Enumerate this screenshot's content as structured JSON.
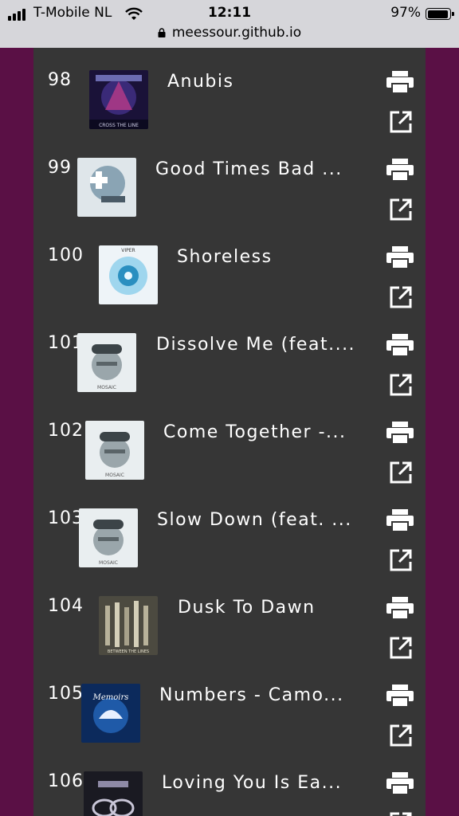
{
  "status_bar": {
    "carrier": "T-Mobile NL",
    "time": "12:11",
    "battery_percent": "97%",
    "url": "meessour.github.io",
    "icons": [
      "signal-icon",
      "wifi-icon",
      "battery-icon",
      "lock-icon"
    ]
  },
  "colors": {
    "page_background": "#5a1045",
    "panel_background": "#363636",
    "text": "#ffffff",
    "status_bar_background": "#d6d6da"
  },
  "tracks": [
    {
      "number": "98",
      "title": "Anubis",
      "cover_caption": "CROSS THE LINE",
      "actions": [
        "print-icon",
        "open-external-icon"
      ]
    },
    {
      "number": "99",
      "title": "Good Times Bad ...",
      "cover_caption": "",
      "actions": [
        "print-icon",
        "open-external-icon"
      ]
    },
    {
      "number": "100",
      "title": "Shoreless",
      "cover_caption": "VIPER",
      "actions": [
        "print-icon",
        "open-external-icon"
      ]
    },
    {
      "number": "101",
      "title": "Dissolve Me (feat....",
      "cover_caption": "MOSAIC",
      "actions": [
        "print-icon",
        "open-external-icon"
      ]
    },
    {
      "number": "102",
      "title": "Come Together -...",
      "cover_caption": "MOSAIC",
      "actions": [
        "print-icon",
        "open-external-icon"
      ]
    },
    {
      "number": "103",
      "title": "Slow Down (feat. ...",
      "cover_caption": "MOSAIC",
      "actions": [
        "print-icon",
        "open-external-icon"
      ]
    },
    {
      "number": "104",
      "title": "Dusk To Dawn",
      "cover_caption": "BETWEEN THE LINES",
      "actions": [
        "print-icon",
        "open-external-icon"
      ]
    },
    {
      "number": "105",
      "title": "Numbers - Camo...",
      "cover_caption": "Memoirs",
      "actions": [
        "print-icon",
        "open-external-icon"
      ]
    },
    {
      "number": "106",
      "title": "Loving You Is Ea...",
      "cover_caption": "",
      "actions": [
        "print-icon",
        "open-external-icon"
      ]
    }
  ]
}
